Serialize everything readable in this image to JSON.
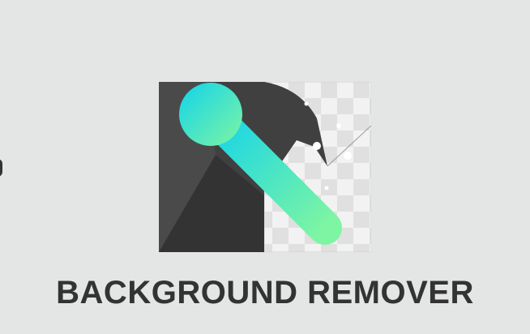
{
  "app": {
    "title": "BACKGROUND REMOVER"
  },
  "logo": {
    "icon": "background-remover-logo-icon",
    "colors": {
      "dark": "#3a3a3a",
      "dark_light": "#4a4a4a",
      "checker_light": "#f2f2f2",
      "checker_dark": "#e0e0e0",
      "gradient_start": "#12d3ea",
      "gradient_end": "#7ef5a3"
    }
  },
  "edge_control": {
    "icon": "partial-edge-icon"
  }
}
